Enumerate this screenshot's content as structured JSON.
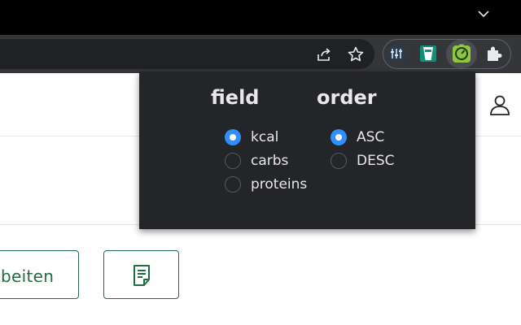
{
  "browser": {
    "icons": [
      "chevron-down-icon",
      "share-icon",
      "star-icon",
      "equalizer-icon",
      "cup-icon",
      "scale-icon",
      "puzzle-icon"
    ],
    "colors": {
      "titlebar": "#000000",
      "toolbar": "#35363a",
      "omnibox": "#202124"
    }
  },
  "popup": {
    "field": {
      "heading": "field",
      "options": [
        {
          "label": "kcal",
          "checked": true
        },
        {
          "label": "carbs",
          "checked": false
        },
        {
          "label": "proteins",
          "checked": false
        }
      ]
    },
    "order": {
      "heading": "order",
      "options": [
        {
          "label": "ASC",
          "checked": true
        },
        {
          "label": "DESC",
          "checked": false
        }
      ]
    },
    "colors": {
      "background": "#232529",
      "radio_checked": "#2f8fff",
      "text": "#e8e8e8"
    }
  },
  "page": {
    "edit_button_label": "beiten",
    "accent": "#1f6b45"
  }
}
